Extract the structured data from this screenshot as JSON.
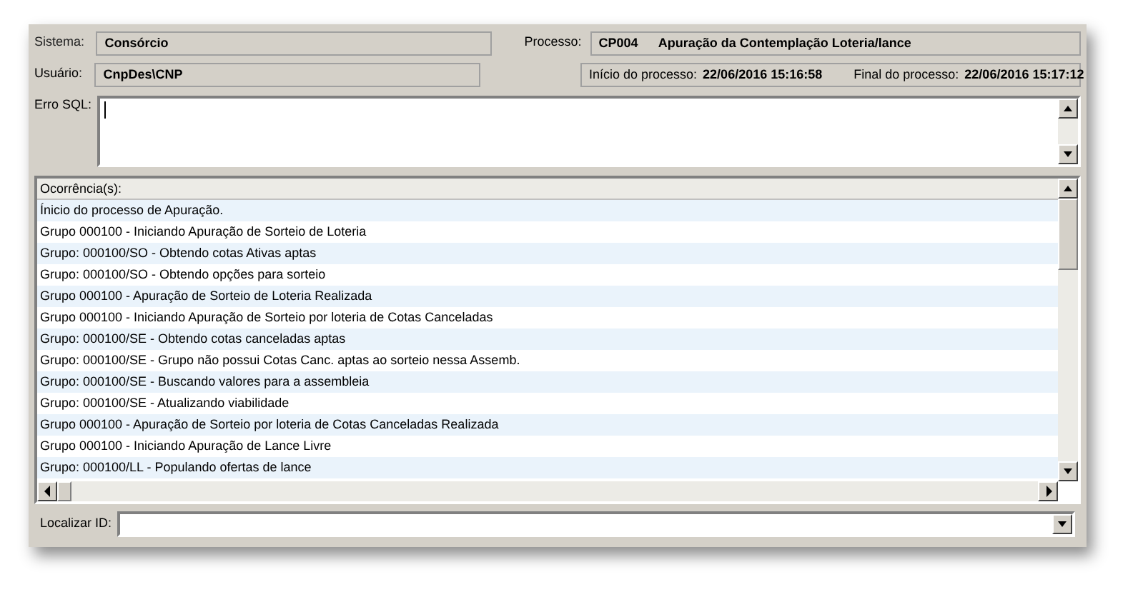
{
  "header": {
    "sistema": {
      "label": "Sistema:",
      "value": "Consórcio"
    },
    "usuario": {
      "label": "Usuário:",
      "value": "CnpDes\\CNP"
    },
    "processo": {
      "label": "Processo:",
      "code": "CP004",
      "name": "Apuração da Contemplação Loteria/lance"
    },
    "inicio": {
      "label": "Início do processo:",
      "value": "22/06/2016 15:16:58"
    },
    "final": {
      "label": "Final do processo:",
      "value": "22/06/2016 15:17:12"
    }
  },
  "erro_sql": {
    "label": "Erro SQL:"
  },
  "ocorrencias": {
    "title": "Ocorrência(s):",
    "rows": [
      "Ínicio do processo de Apuração.",
      "Grupo 000100 - Iniciando Apuração de Sorteio de Loteria",
      "Grupo: 000100/SO - Obtendo cotas Ativas aptas",
      "Grupo: 000100/SO - Obtendo opções para sorteio",
      "Grupo 000100 - Apuração de Sorteio de Loteria Realizada",
      "Grupo 000100 -  Iniciando Apuração de Sorteio por loteria de Cotas Canceladas",
      "Grupo: 000100/SE - Obtendo cotas canceladas aptas",
      "Grupo: 000100/SE - Grupo não possui Cotas Canc. aptas ao sorteio nessa Assemb.",
      "Grupo: 000100/SE - Buscando valores para a assembleia",
      "Grupo: 000100/SE - Atualizando viabilidade",
      "Grupo 000100 - Apuração de Sorteio por loteria de Cotas Canceladas Realizada",
      "Grupo 000100 - Iniciando Apuração de Lance Livre",
      "Grupo: 000100/LL - Populando ofertas de lance"
    ]
  },
  "localizar": {
    "label": "Localizar ID:"
  }
}
